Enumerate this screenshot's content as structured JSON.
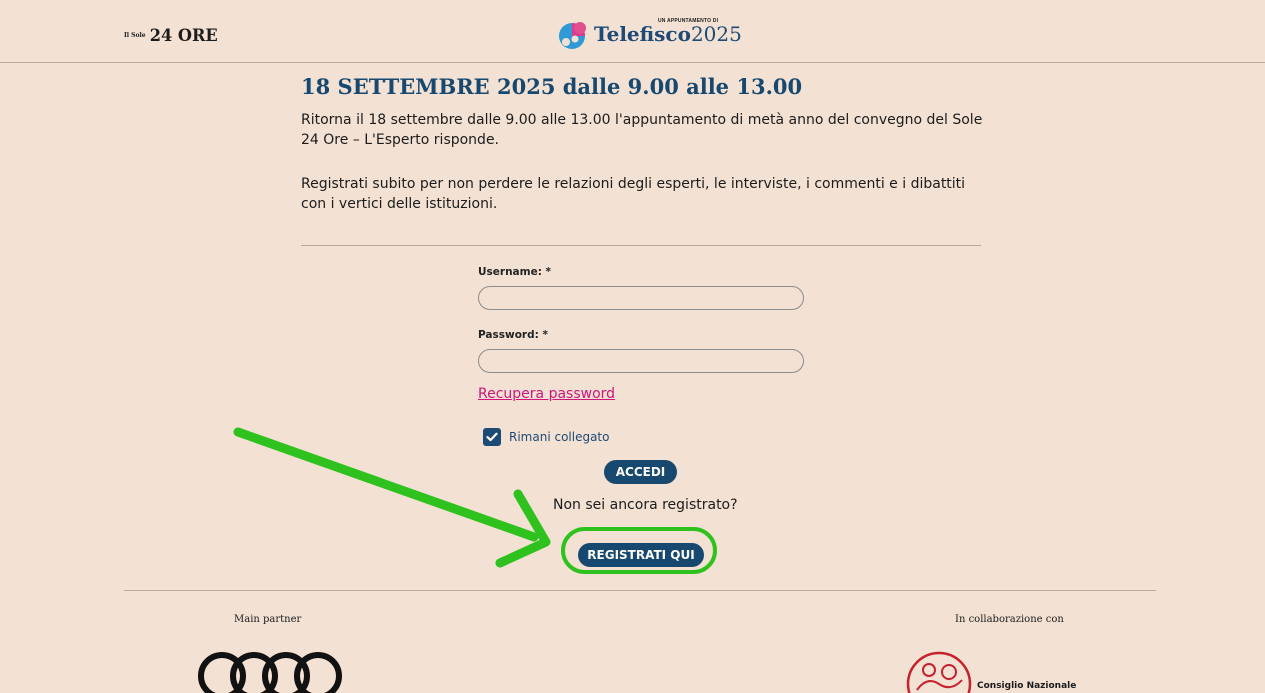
{
  "header": {
    "sole_logo_small": "Il Sole",
    "sole_logo_big": "24 ORE",
    "telefisco_tag": "UN APPUNTAMENTO DI",
    "telefisco_word": "Telefisco",
    "telefisco_year": "2025"
  },
  "main": {
    "title": "18 SETTEMBRE 2025 dalle 9.00 alle 13.00",
    "intro": "Ritorna il 18 settembre dalle 9.00 alle 13.00 l'appuntamento di metà anno del convegno del Sole 24 Ore – L'Esperto risponde.",
    "cta_text": "Registrati subito per non perdere le relazioni degli esperti, le interviste, i commenti e i dibattiti con i vertici delle istituzioni."
  },
  "form": {
    "username_label": "Username: *",
    "username_value": "",
    "password_label": "Password: *",
    "password_value": "",
    "recover_link": "Recupera password",
    "remember_label": "Rimani collegato",
    "remember_checked": true,
    "login_button": "ACCEDI",
    "not_registered": "Non sei ancora registrato?",
    "register_button": "REGISTRATI QUI"
  },
  "footer": {
    "main_partner": "Main partner",
    "collaboration": "In collaborazione con",
    "cn_text": "Consiglio Nazionale"
  },
  "colors": {
    "background": "#f3e1d3",
    "brand_blue": "#17486f",
    "link_pink": "#d0157b",
    "highlight_green": "#2fc21e"
  },
  "icons": [
    "checkmark-icon",
    "telefisco-logo-icon",
    "audi-rings-icon",
    "cn-logo-icon",
    "arrow-annotation-icon"
  ]
}
